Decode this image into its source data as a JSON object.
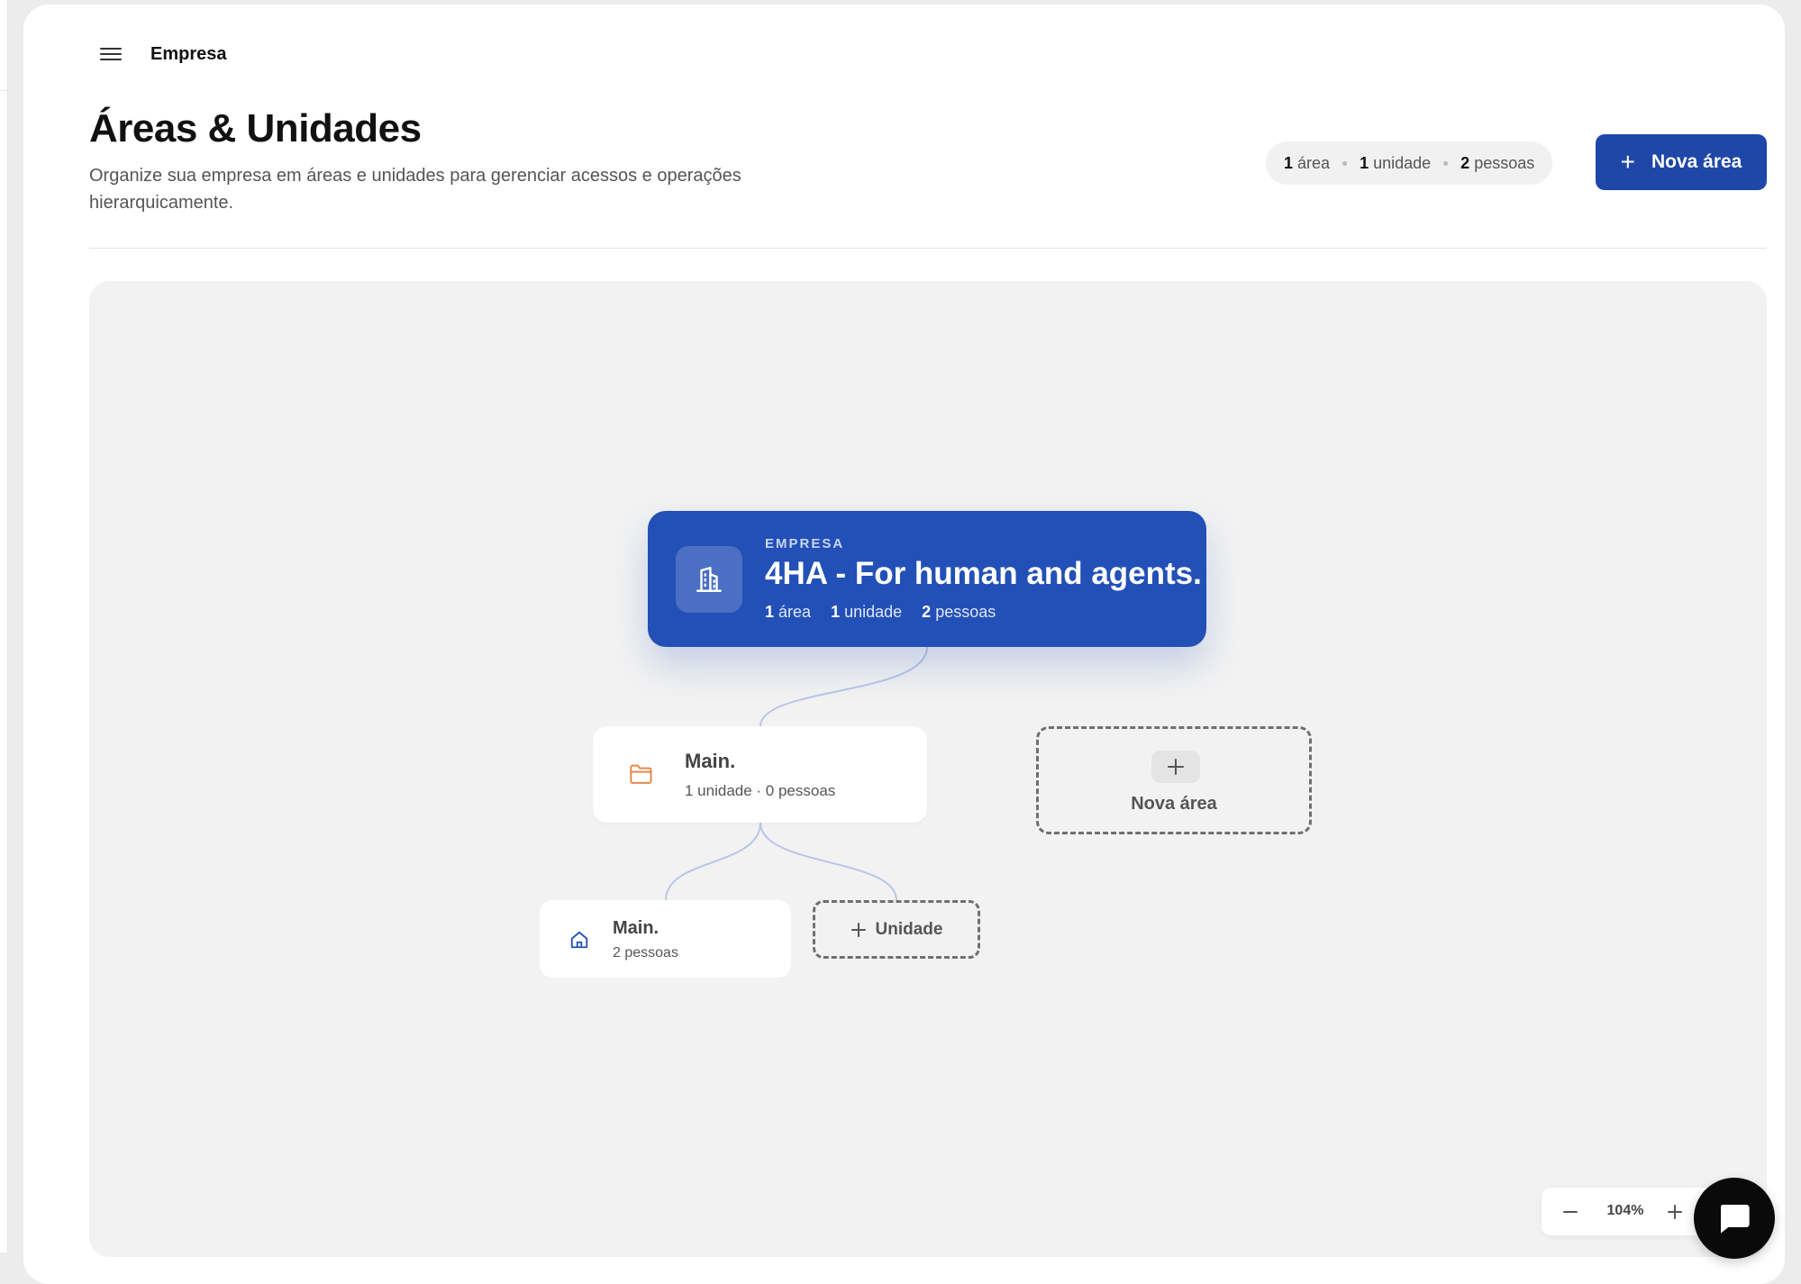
{
  "header": {
    "breadcrumb": "Empresa"
  },
  "page": {
    "title": "Áreas & Unidades",
    "subtitle": "Organize sua empresa em áreas e unidades para gerenciar acessos e operações hierarquicamente."
  },
  "summary": {
    "areas_count": "1",
    "areas_label": "área",
    "units_count": "1",
    "units_label": "unidade",
    "people_count": "2",
    "people_label": "pessoas"
  },
  "actions": {
    "new_area_label": "Nova área"
  },
  "org": {
    "company": {
      "eyebrow": "EMPRESA",
      "name": "4HA - For human and agents.",
      "areas_count": "1",
      "areas_label": "área",
      "units_count": "1",
      "units_label": "unidade",
      "people_count": "2",
      "people_label": "pessoas"
    },
    "area": {
      "title": "Main.",
      "meta": "1 unidade · 0 pessoas"
    },
    "unit": {
      "title": "Main.",
      "meta": "2 pessoas"
    },
    "new_area_card_label": "Nova área",
    "add_unit_label": "Unidade"
  },
  "zoom": {
    "level": "104%"
  },
  "colors": {
    "primary": "#1f47a8",
    "company_card": "#2350b6",
    "folder_icon": "#e8894a",
    "home_icon": "#2350b6",
    "canvas_bg": "#f2f2f2"
  },
  "icons": {
    "menu": "menu-icon",
    "company": "building-icon",
    "area": "folder-icon",
    "unit": "home-icon",
    "chat": "chat-icon"
  }
}
